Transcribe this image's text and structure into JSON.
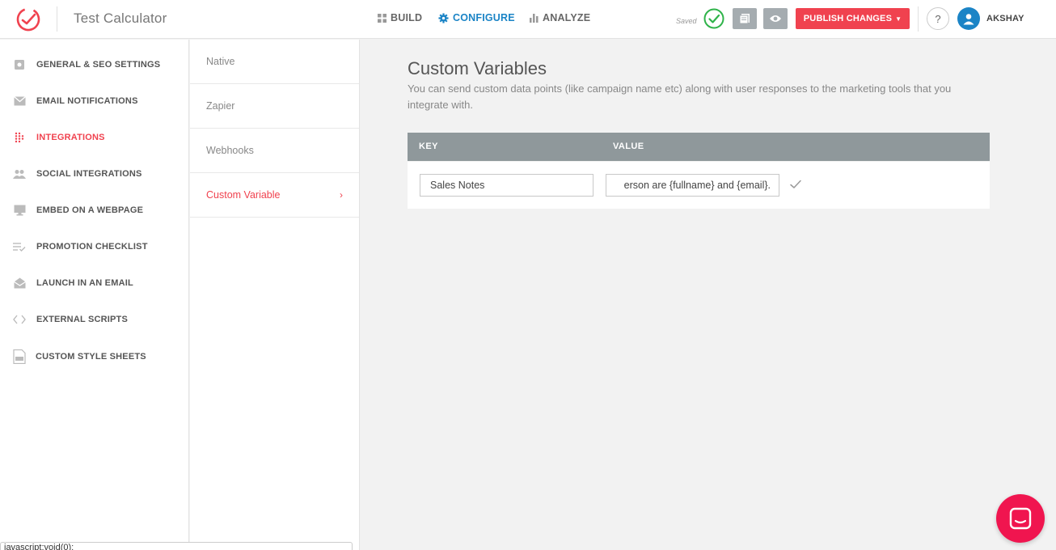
{
  "header": {
    "app_title": "Test Calculator",
    "nav": [
      {
        "label": "BUILD",
        "icon": "grid-icon"
      },
      {
        "label": "CONFIGURE",
        "icon": "gear-icon"
      },
      {
        "label": "ANALYZE",
        "icon": "bar-chart-icon"
      }
    ],
    "saved_label": "Saved",
    "publish_label": "PUBLISH CHANGES",
    "help_label": "?",
    "user_name": "AKSHAY"
  },
  "sidebar": {
    "items": [
      {
        "label": "GENERAL & SEO SETTINGS",
        "icon": "settings-icon"
      },
      {
        "label": "EMAIL NOTIFICATIONS",
        "icon": "envelope-icon"
      },
      {
        "label": "INTEGRATIONS",
        "icon": "dots-grid-icon"
      },
      {
        "label": "SOCIAL INTEGRATIONS",
        "icon": "people-icon"
      },
      {
        "label": "EMBED ON A WEBPAGE",
        "icon": "monitor-icon"
      },
      {
        "label": "PROMOTION CHECKLIST",
        "icon": "checklist-icon"
      },
      {
        "label": "LAUNCH IN AN EMAIL",
        "icon": "open-envelope-icon"
      },
      {
        "label": "EXTERNAL SCRIPTS",
        "icon": "code-icon"
      },
      {
        "label": "CUSTOM STYLE SHEETS",
        "icon": "css-file-icon"
      }
    ]
  },
  "submenu": {
    "items": [
      {
        "label": "Native"
      },
      {
        "label": "Zapier"
      },
      {
        "label": "Webhooks"
      },
      {
        "label": "Custom Variable"
      }
    ]
  },
  "main": {
    "title": "Custom Variables",
    "description": "You can send custom data points (like campaign name etc) along with user responses to the marketing tools that you integrate with.",
    "columns": {
      "key": "KEY",
      "value": "VALUE"
    },
    "rows": [
      {
        "key": "Sales Notes",
        "value": "erson are {fullname} and {email}."
      }
    ]
  },
  "status_bar": {
    "text": "javascript:void(0);"
  },
  "colors": {
    "accent_red": "#f0424f",
    "accent_blue": "#1b84c6",
    "success_green": "#2fb34a",
    "table_header": "#8f989b"
  }
}
